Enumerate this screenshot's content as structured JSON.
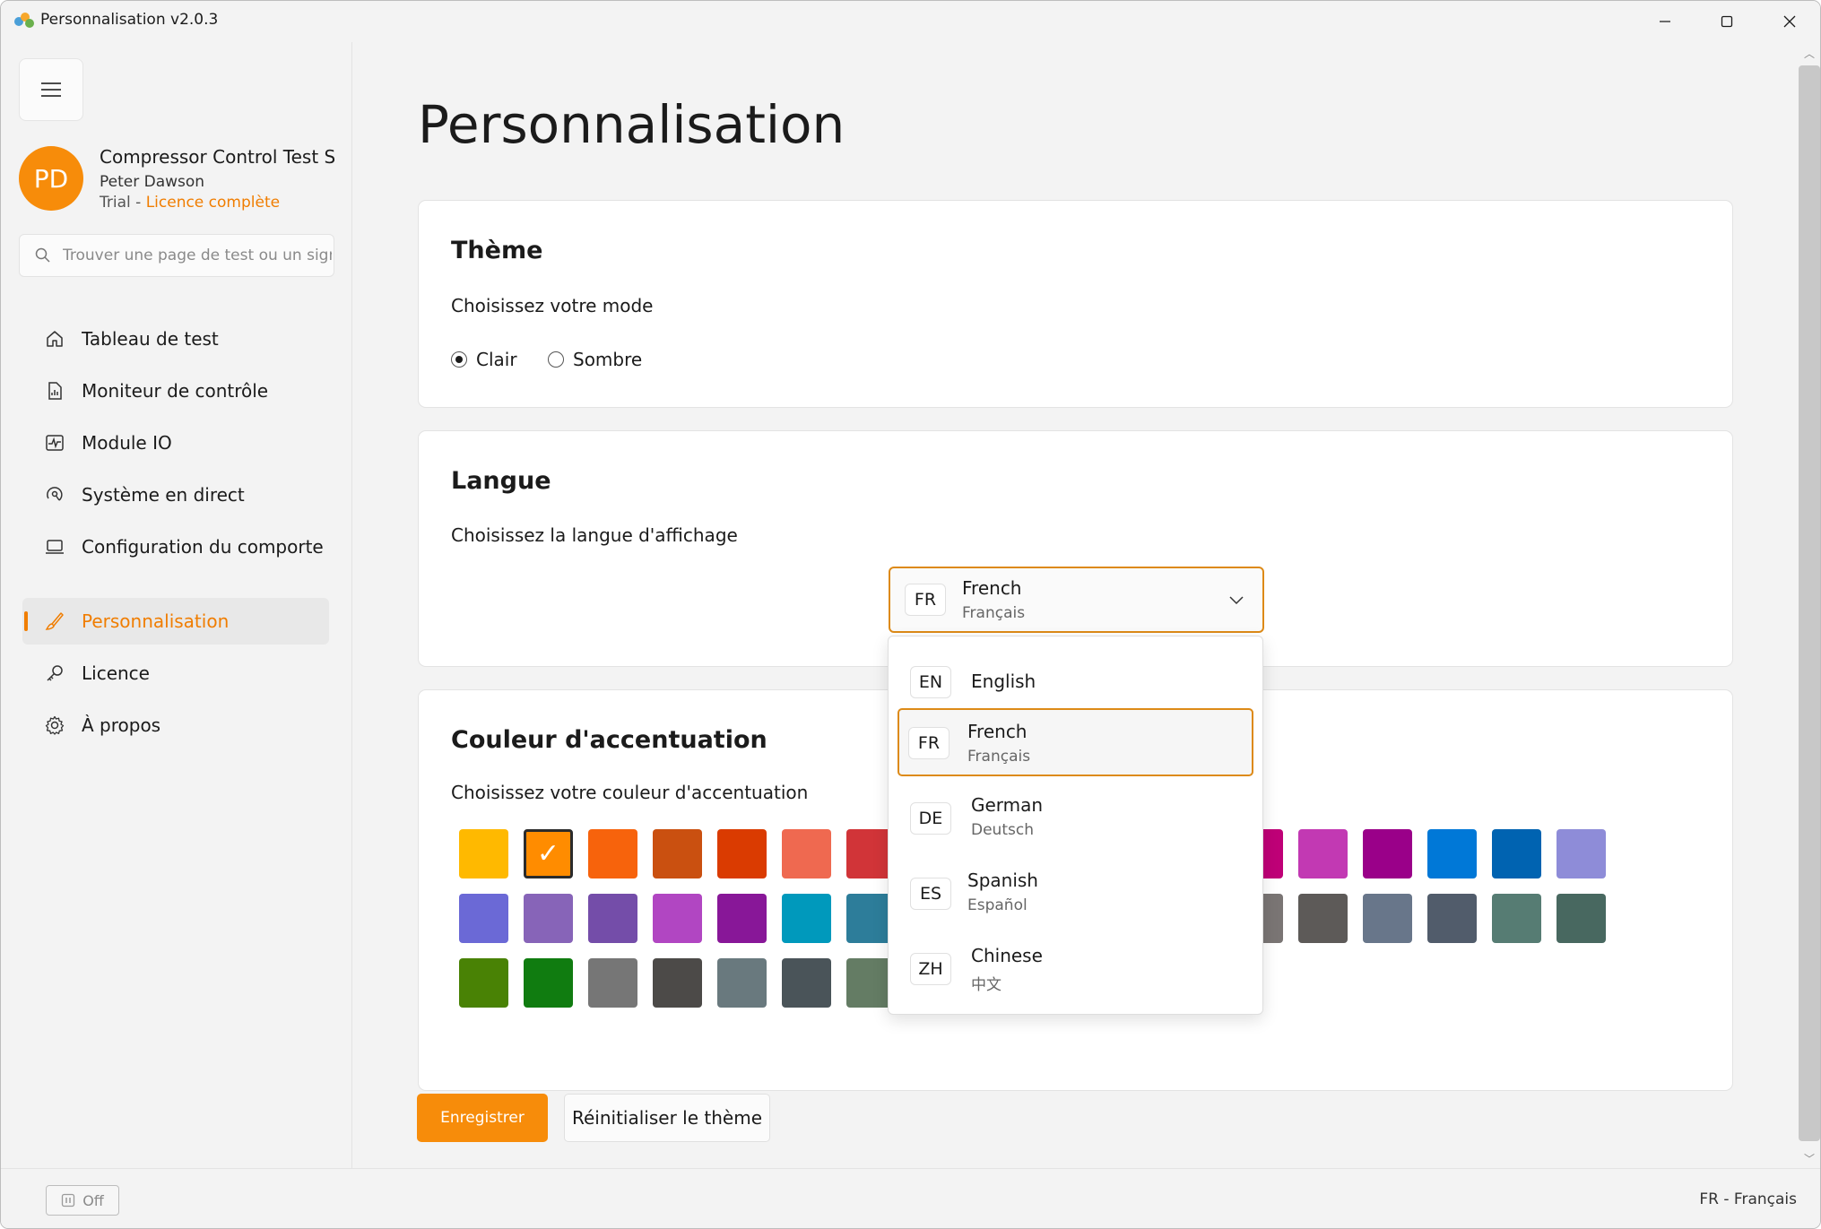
{
  "window": {
    "title": "Personnalisation v2.0.3"
  },
  "sidebar": {
    "user": {
      "initials": "PD",
      "app_name": "Compressor Control Test Simulator",
      "name": "Peter Dawson",
      "plan": "Trial - ",
      "license_link": "Licence complète"
    },
    "search": {
      "placeholder": "Trouver une page de test ou un signal"
    },
    "items": [
      {
        "label": "Tableau de test",
        "icon": "home-icon"
      },
      {
        "label": "Moniteur de contrôle",
        "icon": "document-chart-icon"
      },
      {
        "label": "Module IO",
        "icon": "pulse-icon"
      },
      {
        "label": "Système en direct",
        "icon": "live-signal-icon"
      },
      {
        "label": "Configuration du comportement",
        "icon": "laptop-icon"
      },
      {
        "label": "Personnalisation",
        "icon": "brush-icon",
        "active": true
      },
      {
        "label": "Licence",
        "icon": "key-icon"
      },
      {
        "label": "À propos",
        "icon": "gear-icon"
      }
    ]
  },
  "main": {
    "title": "Personnalisation",
    "theme": {
      "title": "Thème",
      "subtitle": "Choisissez votre mode",
      "options": [
        "Clair",
        "Sombre"
      ],
      "selected": "Clair"
    },
    "language": {
      "title": "Langue",
      "subtitle": "Choisissez la langue d'affichage",
      "selected": {
        "code": "FR",
        "name": "French",
        "native": "Français"
      },
      "options": [
        {
          "code": "EN",
          "name": "English",
          "native": ""
        },
        {
          "code": "FR",
          "name": "French",
          "native": "Français",
          "selected": true
        },
        {
          "code": "DE",
          "name": "German",
          "native": "Deutsch"
        },
        {
          "code": "ES",
          "name": "Spanish",
          "native": "Español"
        },
        {
          "code": "ZH",
          "name": "Chinese",
          "native": "中文"
        }
      ]
    },
    "accent": {
      "title": "Couleur d'accentuation",
      "subtitle": "Choisissez votre couleur d'accentuation",
      "selected_index": 1,
      "check_glyph": "✓",
      "rows": [
        [
          "#ffb900",
          "#ff8c00",
          "#f7630c",
          "#ca5010",
          "#da3b01",
          "#ef6950",
          "#d13438",
          "#ff4343",
          "#e74856",
          "#e81123",
          "#ea005e",
          "#e3008c",
          "#bf0077",
          "#c239b3",
          "#9a0089",
          "#0078d7",
          "#0063b1",
          "#8e8cd8"
        ],
        [
          "#6b69d6",
          "#8764b8",
          "#744da9",
          "#b146c2",
          "#881798",
          "#0099bc",
          "#2d7d9a",
          "#00b7c3",
          "#038387",
          "#00b294",
          "#018574",
          "#10893e",
          "#7a7574",
          "#5d5a58",
          "#68768a",
          "#515c6b",
          "#567c73",
          "#486860"
        ],
        [
          "#498205",
          "#107c10",
          "#767676",
          "#4c4a48",
          "#69797e",
          "#4a5459",
          "#647c64"
        ]
      ]
    },
    "buttons": {
      "save": "Enregistrer",
      "reset": "Réinitialiser le thème"
    }
  },
  "statusbar": {
    "toggle_label": "Off",
    "language": "FR - Français"
  }
}
